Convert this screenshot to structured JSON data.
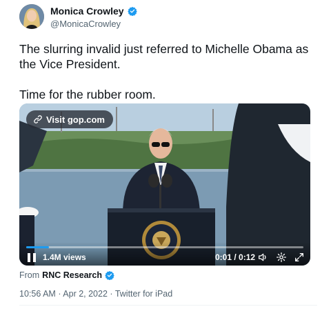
{
  "author": {
    "name": "Monica Crowley",
    "handle": "@MonicaCrowley",
    "verified": true
  },
  "tweet": {
    "text": "The slurring invalid just referred to Michelle Obama as the Vice President.\n\nTime for the rubber room."
  },
  "media": {
    "link_label": "Visit gop.com",
    "views": "1.4M views",
    "time": "0:01 / 0:12",
    "progress": 0.083
  },
  "source": {
    "prefix": "From",
    "name": "RNC Research",
    "verified": true
  },
  "meta": {
    "time": "10:56 AM",
    "sep1": "·",
    "date": "Apr 2, 2022",
    "sep2": "·",
    "client": "Twitter for iPad"
  },
  "colors": {
    "accent": "#1d9bf0",
    "text": "#0f1419",
    "secondary": "#536471"
  },
  "icons": [
    "verified-badge-icon",
    "link-icon",
    "pause-icon",
    "volume-icon",
    "settings-icon",
    "fullscreen-icon"
  ]
}
